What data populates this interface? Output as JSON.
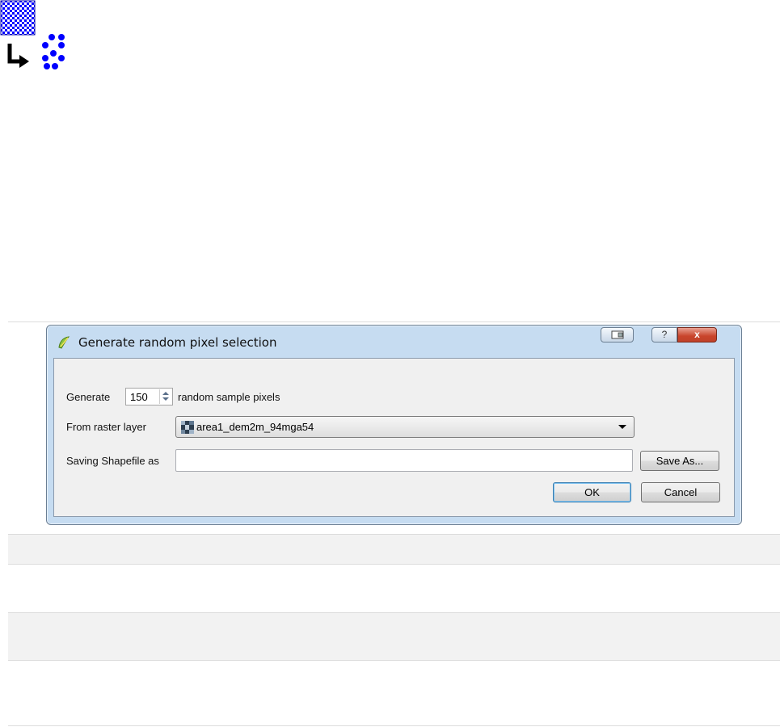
{
  "plugin_icon": {
    "name": "random-pixel-selection-plugin-icon"
  },
  "dialog": {
    "title": "Generate random pixel selection",
    "app_icon": "qgis-icon",
    "caption_buttons": {
      "help": "?",
      "close": "x"
    },
    "generate_label": "Generate",
    "sample_count": "150",
    "sample_suffix": "random sample pixels",
    "raster_label": "From raster layer",
    "raster_layer": "area1_dem2m_94mga54",
    "save_label": "Saving Shapefile as",
    "save_path": "",
    "save_as_button": "Save As...",
    "ok_button": "OK",
    "cancel_button": "Cancel"
  },
  "colors": {
    "dialog_frame": "#c6dcf1",
    "client_bg": "#f0f0f0",
    "close_button": "#c8442b",
    "plugin_blue": "#0000ff"
  }
}
